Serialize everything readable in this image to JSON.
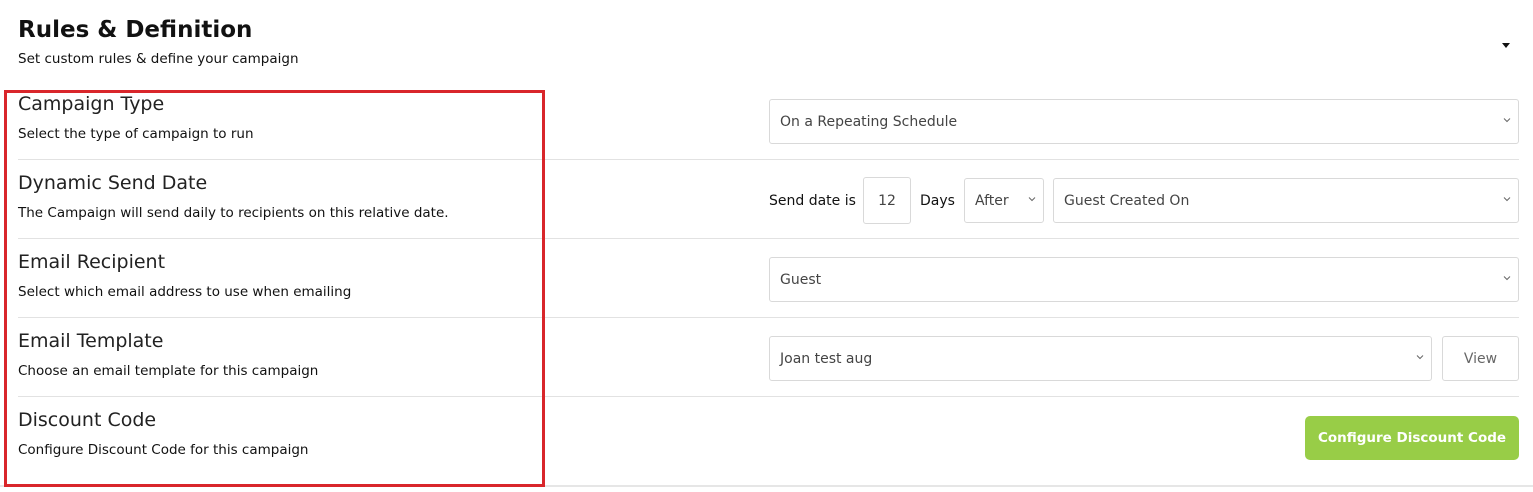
{
  "header": {
    "title": "Rules & Definition",
    "subtitle": "Set custom rules & define your campaign"
  },
  "rows": {
    "campaign_type": {
      "title": "Campaign Type",
      "description": "Select the type of campaign to run",
      "selected": "On a Repeating Schedule"
    },
    "dynamic_send_date": {
      "title": "Dynamic Send Date",
      "description": "The Campaign will send daily to recipients on this relative date.",
      "label_prefix": "Send date is",
      "days_value": "12",
      "label_days": "Days",
      "relation_selected": "After",
      "field_selected": "Guest Created On"
    },
    "email_recipient": {
      "title": "Email Recipient",
      "description": "Select which email address to use when emailing",
      "selected": "Guest"
    },
    "email_template": {
      "title": "Email Template",
      "description": "Choose an email template for this campaign",
      "selected": "Joan test aug",
      "view_label": "View"
    },
    "discount_code": {
      "title": "Discount Code",
      "description": "Configure Discount Code for this campaign",
      "button_label": "Configure Discount Code"
    }
  },
  "colors": {
    "accent_green": "#98cd47",
    "highlight_red": "#d9262b",
    "border_gray": "#d9d9d9"
  }
}
